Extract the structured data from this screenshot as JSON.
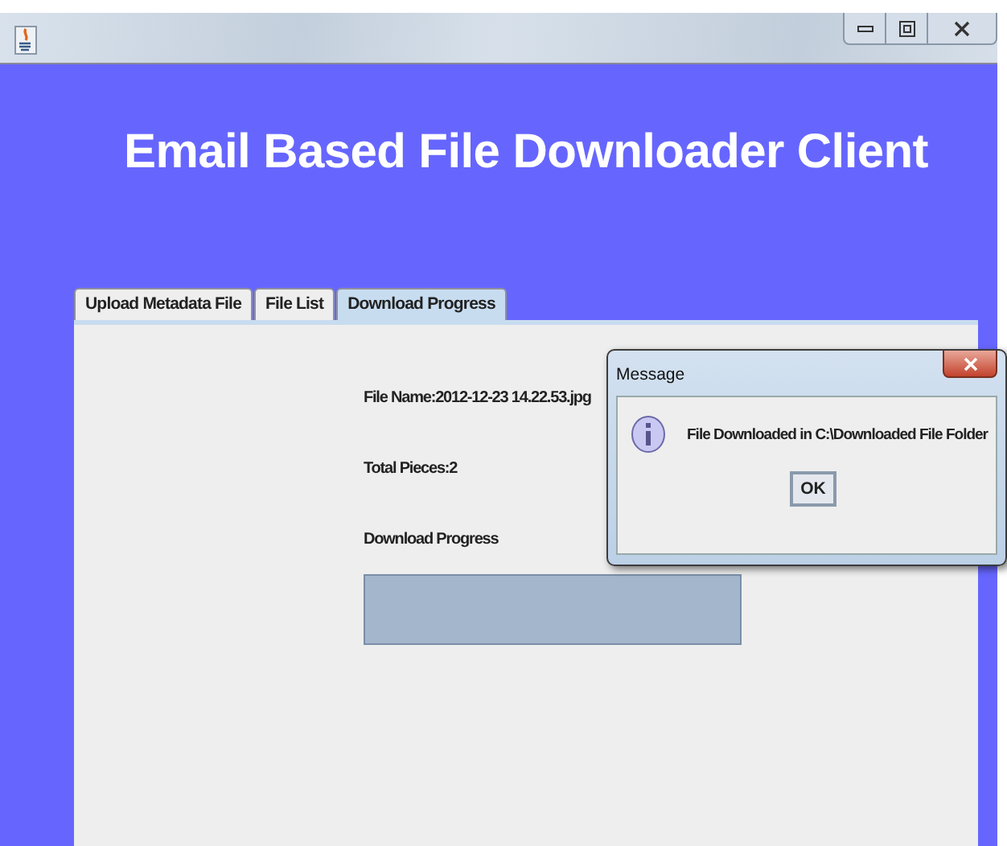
{
  "heading": "Email Based File Downloader Client",
  "tabs": [
    {
      "label": "Upload Metadata File",
      "selected": false
    },
    {
      "label": "File List",
      "selected": false
    },
    {
      "label": "Download Progress",
      "selected": true
    }
  ],
  "panel": {
    "file_name": "File Name:2012-12-23 14.22.53.jpg",
    "total_pieces": "Total Pieces:2",
    "progress_label": "Download Progress",
    "progress": {
      "level": 0
    }
  },
  "dialog": {
    "title": "Message",
    "message": "File Downloaded in C:\\Downloaded File Folder",
    "button": "OK"
  }
}
